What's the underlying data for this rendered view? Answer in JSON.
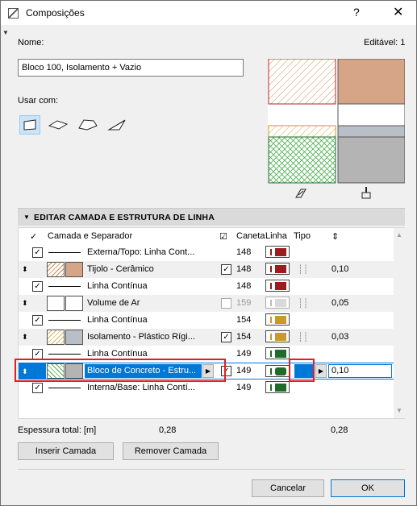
{
  "window": {
    "title": "Composições",
    "help": "?",
    "close": "✕"
  },
  "name": {
    "label": "Nome:",
    "value": "Bloco 100, Isolamento + Vazio"
  },
  "editable": "Editável: 1",
  "use_with": {
    "label": "Usar com:"
  },
  "section": {
    "title": "EDITAR CAMADA E ESTRUTURA DE LINHA"
  },
  "table": {
    "headers": {
      "check": "✓",
      "layer": "Camada e Separador",
      "pen": "Caneta",
      "line": "Linha",
      "type": "Tipo"
    },
    "rows": [
      {
        "kind": "sep",
        "label": "Externa/Topo: Linha Cont...",
        "pen": "148",
        "color": "#9b1c1c"
      },
      {
        "kind": "layer",
        "label": "Tijolo - Cerâmico",
        "pen": "148",
        "color": "#9b1c1c",
        "thickness": "0,10",
        "fill": "#d6a587",
        "hatch": "#c88b4a"
      },
      {
        "kind": "sep",
        "label": "Linha Contínua",
        "pen": "148",
        "color": "#9b1c1c"
      },
      {
        "kind": "layer",
        "label": "Volume de Ar",
        "pen": "159",
        "color": "#d9d9d9",
        "thickness": "0,05",
        "fill": "#ffffff",
        "hatch": "none"
      },
      {
        "kind": "sep",
        "label": "Linha Contínua",
        "pen": "154",
        "color": "#c89a2a"
      },
      {
        "kind": "layer",
        "label": "Isolamento - Plástico Rígi...",
        "pen": "154",
        "color": "#c89a2a",
        "thickness": "0,03",
        "fill": "#b9bfc6",
        "hatch": "#d6b35a"
      },
      {
        "kind": "sep",
        "label": "Linha Contínua",
        "pen": "149",
        "color": "#1f6b2a"
      },
      {
        "kind": "layer",
        "label": "Bloco de Concreto - Estru...",
        "pen": "149",
        "color": "#1f6b2a",
        "thickness": "0,10",
        "fill": "#b4b4b4",
        "hatch": "#4caf50",
        "selected": true
      },
      {
        "kind": "sep",
        "label": "Interna/Base: Linha Contí...",
        "pen": "149",
        "color": "#1f6b2a"
      }
    ]
  },
  "total": {
    "label": "Espessura total: [m]",
    "value1": "0,28",
    "value2": "0,28"
  },
  "buttons": {
    "insert": "Inserir Camada",
    "remove": "Remover Camada",
    "cancel": "Cancelar",
    "ok": "OK"
  }
}
